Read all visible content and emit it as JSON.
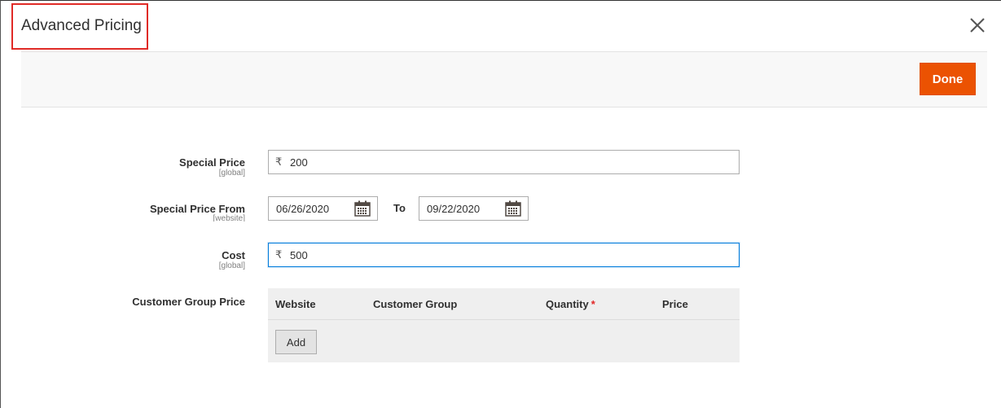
{
  "modal": {
    "title": "Advanced Pricing",
    "close_icon": "close-icon",
    "done_label": "Done",
    "accent_color": "#eb5202",
    "highlight_color": "#e02b27"
  },
  "fields": {
    "special_price": {
      "label": "Special Price",
      "scope": "[global]",
      "currency": "₹",
      "value": "200"
    },
    "special_price_from": {
      "label": "Special Price From",
      "scope": "[website]",
      "from_value": "06/26/2020",
      "to_label": "To",
      "to_value": "09/22/2020",
      "icon": "calendar-icon"
    },
    "cost": {
      "label": "Cost",
      "scope": "[global]",
      "currency": "₹",
      "value": "500"
    },
    "customer_group_price": {
      "label": "Customer Group Price",
      "columns": [
        "Website",
        "Customer Group",
        "Quantity",
        "Price"
      ],
      "required_marker": "*",
      "add_label": "Add"
    }
  }
}
